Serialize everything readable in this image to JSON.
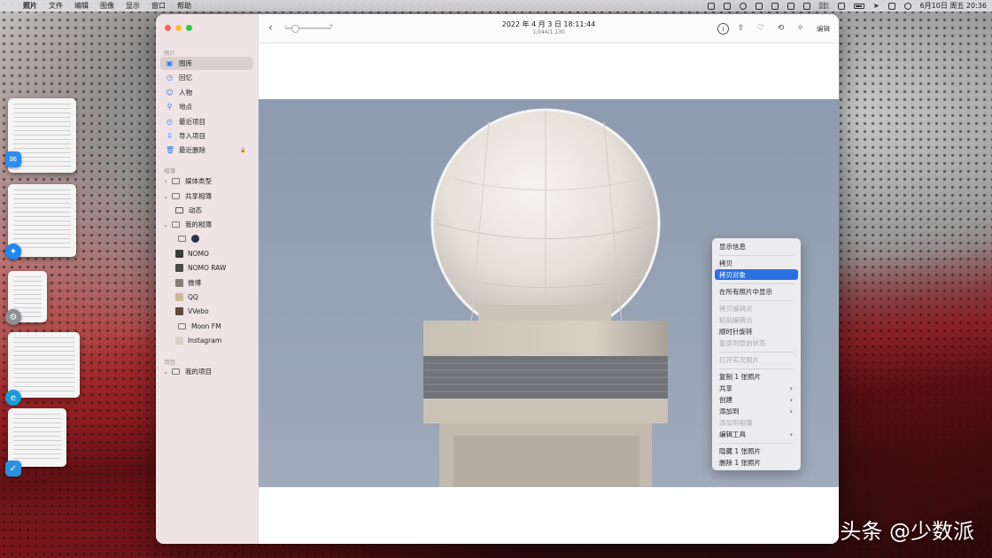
{
  "menubar": {
    "apple": "",
    "app": "照片",
    "menus": [
      "文件",
      "编辑",
      "图像",
      "显示",
      "窗口",
      "帮助"
    ],
    "net_up": "0KB/s",
    "net_down": "0KB/s",
    "clock": "6月10日 周五 20:36"
  },
  "sidebar": {
    "section_photos": "照片",
    "items": [
      {
        "label": "图库",
        "icon": "photo-library-icon",
        "glyph": "▣"
      },
      {
        "label": "回忆",
        "icon": "memories-icon",
        "glyph": "◷"
      },
      {
        "label": "人物",
        "icon": "people-icon",
        "glyph": "☺"
      },
      {
        "label": "地点",
        "icon": "places-icon",
        "glyph": "⚲"
      },
      {
        "label": "最近项目",
        "icon": "recents-icon",
        "glyph": "◴"
      },
      {
        "label": "导入项目",
        "icon": "imports-icon",
        "glyph": "⇩"
      },
      {
        "label": "最近删除",
        "icon": "trash-icon",
        "glyph": "🗑"
      }
    ],
    "section_albums": "相簿",
    "albums": {
      "media_types": "媒体类型",
      "shared": "共享相簿",
      "activity": "动态",
      "my_albums": "我的相簿",
      "list": [
        "NOMO",
        "NOMO RAW",
        "微博",
        "QQ",
        "VVebo",
        "Moon FM",
        "Instagram"
      ]
    },
    "section_projects": "项目",
    "my_projects": "我的项目"
  },
  "toolbar": {
    "back": "‹",
    "zoom_minus": "−",
    "zoom_plus": "+",
    "zoom_level": 0.15,
    "title": "2022 年 4 月 3 日 18:11:44",
    "subtitle": "1,044/1,130",
    "edit": "编辑"
  },
  "context_menu": {
    "items": [
      {
        "label": "显示信息"
      },
      {
        "label": "拷贝"
      },
      {
        "label": "拷贝对象",
        "highlight": true
      },
      {
        "label": "在所有照片中显示"
      },
      {
        "label": "拷贝编辑点",
        "disabled": true
      },
      {
        "label": "粘贴编辑点",
        "disabled": true
      },
      {
        "label": "顺时针旋转"
      },
      {
        "label": "复原到原始状态",
        "disabled": true
      },
      {
        "label": "打开实况照片",
        "disabled": true
      },
      {
        "label": "复制 1 张照片"
      },
      {
        "label": "共享",
        "submenu": true
      },
      {
        "label": "创建",
        "submenu": true
      },
      {
        "label": "添加到",
        "submenu": true
      },
      {
        "label": "添加到相簿",
        "disabled": true
      },
      {
        "label": "编辑工具",
        "submenu": true
      },
      {
        "label": "隐藏 1 张照片"
      },
      {
        "label": "删除 1 张照片"
      }
    ],
    "submenu_arrow": "›"
  },
  "watermark": "头条 @少数派",
  "colors": {
    "accent": "#2c6fe0",
    "sidebar_icon": "#2b7de9"
  }
}
